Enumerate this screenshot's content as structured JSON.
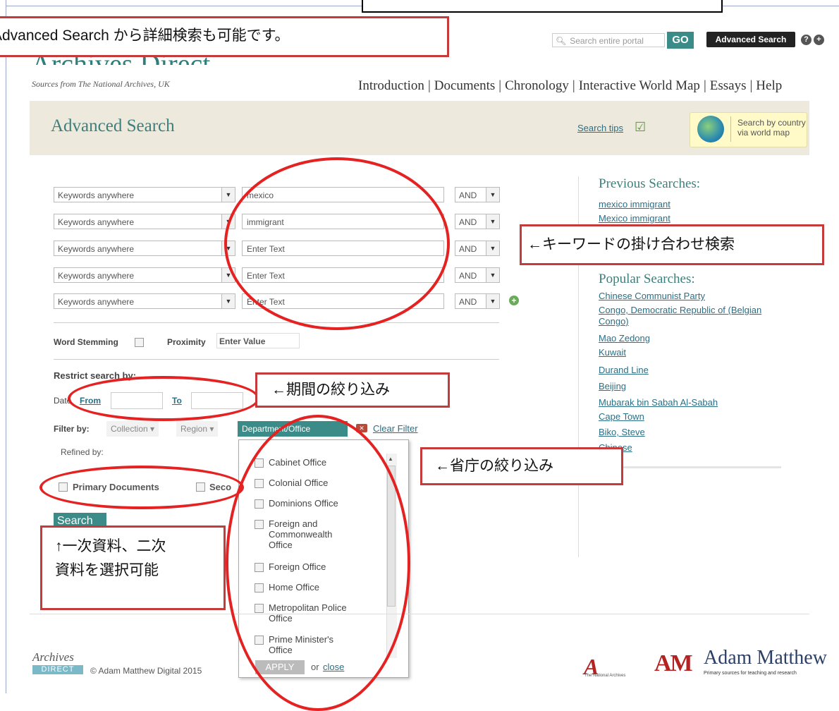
{
  "header": {
    "logo_title": "Archives Direct",
    "logo_subtitle": "Sources from The National Archives, UK",
    "search_placeholder": "Search entire portal",
    "go_label": "GO",
    "advanced_search_label": "Advanced Search",
    "nav": [
      "Introduction",
      "Documents",
      "Chronology",
      "Interactive World Map",
      "Essays",
      "Help"
    ]
  },
  "band": {
    "title": "Advanced Search",
    "search_tips": "Search tips",
    "world_map_line1": "Search by country",
    "world_map_line2": "via world map"
  },
  "keyword_rows": [
    {
      "field": "Keywords anywhere",
      "value": "mexico",
      "operator": "AND"
    },
    {
      "field": "Keywords anywhere",
      "value": "immigrant",
      "operator": "AND"
    },
    {
      "field": "Keywords anywhere",
      "value": "Enter Text",
      "operator": "AND"
    },
    {
      "field": "Keywords anywhere",
      "value": "Enter Text",
      "operator": "AND"
    },
    {
      "field": "Keywords anywhere",
      "value": "Enter Text",
      "operator": "AND"
    }
  ],
  "options": {
    "word_stemming": "Word Stemming",
    "proximity": "Proximity",
    "proximity_value": "Enter Value"
  },
  "restrict": {
    "title": "Restrict search by:",
    "date_label": "Date",
    "from": "From",
    "to": "To"
  },
  "filter": {
    "label": "Filter by:",
    "tabs": [
      "Collection",
      "Region",
      "Department/Office"
    ],
    "clear": "Clear Filter",
    "refined_by": "Refined by:"
  },
  "doc_types": [
    "Primary Documents",
    "Seco"
  ],
  "search_button": "Search",
  "departments": [
    "Cabinet Office",
    "Colonial Office",
    "Dominions Office",
    "Foreign and Commonwealth Office",
    "Foreign Office",
    "Home Office",
    "Metropolitan Police Office",
    "Prime Minister's Office"
  ],
  "dept_apply": "APPLY",
  "dept_or": "or",
  "dept_close": "close",
  "previous_searches": {
    "title": "Previous Searches:",
    "items": [
      "mexico immigrant",
      "Mexico immigrant"
    ]
  },
  "popular_searches": {
    "title": "Popular Searches:",
    "items": [
      "Chinese Communist Party",
      "Congo, Democratic Republic of (Belgian Congo)",
      "Mao Zedong",
      "Kuwait",
      "Durand Line",
      "Beijing",
      "Mubarak bin Sabah Al-Sabah",
      "Cape Town",
      "Biko, Steve",
      "Chinese"
    ]
  },
  "footer": {
    "logo_top": "Archives",
    "logo_bottom": "DIRECT",
    "copyright": "© Adam Matthew Digital 2015",
    "na_caption": "The National Archives",
    "am_mark": "AM",
    "am_name": "Adam Matthew",
    "am_tagline": "Primary sources for teaching and research"
  },
  "annotations": {
    "advanced": "Advanced Search から詳細検索も可能です。",
    "keywords": "←キーワードの掛け合わせ検索",
    "period": "←期間の絞り込み",
    "ministry": "←省庁の絞り込み",
    "primary_line1": "↑一次資料、二次",
    "primary_line2": "資料を選択可能"
  },
  "colors": {
    "accent": "#3b8c88",
    "annotation_border": "#c53a3a",
    "ellipse": "#e52222"
  }
}
